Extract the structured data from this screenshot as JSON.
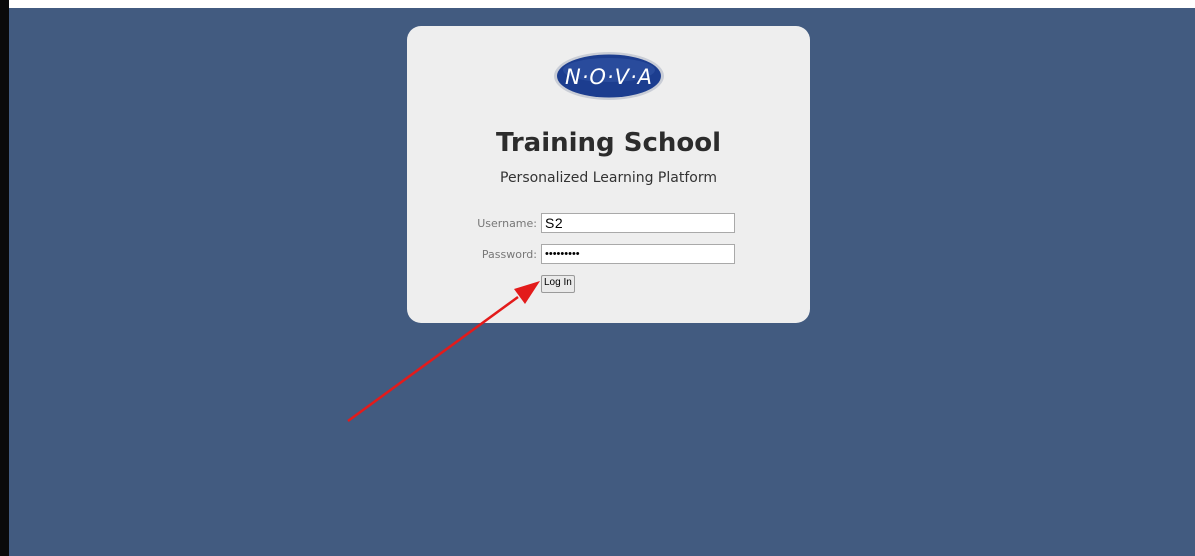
{
  "logo": {
    "text": "N·O·V·A"
  },
  "card": {
    "title": "Training School",
    "subtitle": "Personalized Learning Platform"
  },
  "form": {
    "username_label": "Username:",
    "username_value": "S2",
    "password_label": "Password:",
    "password_value": "•••••••••",
    "login_label": "Log In"
  },
  "colors": {
    "background": "#425b80",
    "card": "#eeeeee",
    "logo_fill": "#1c3d8f",
    "annotation_arrow": "#e31b1b"
  }
}
